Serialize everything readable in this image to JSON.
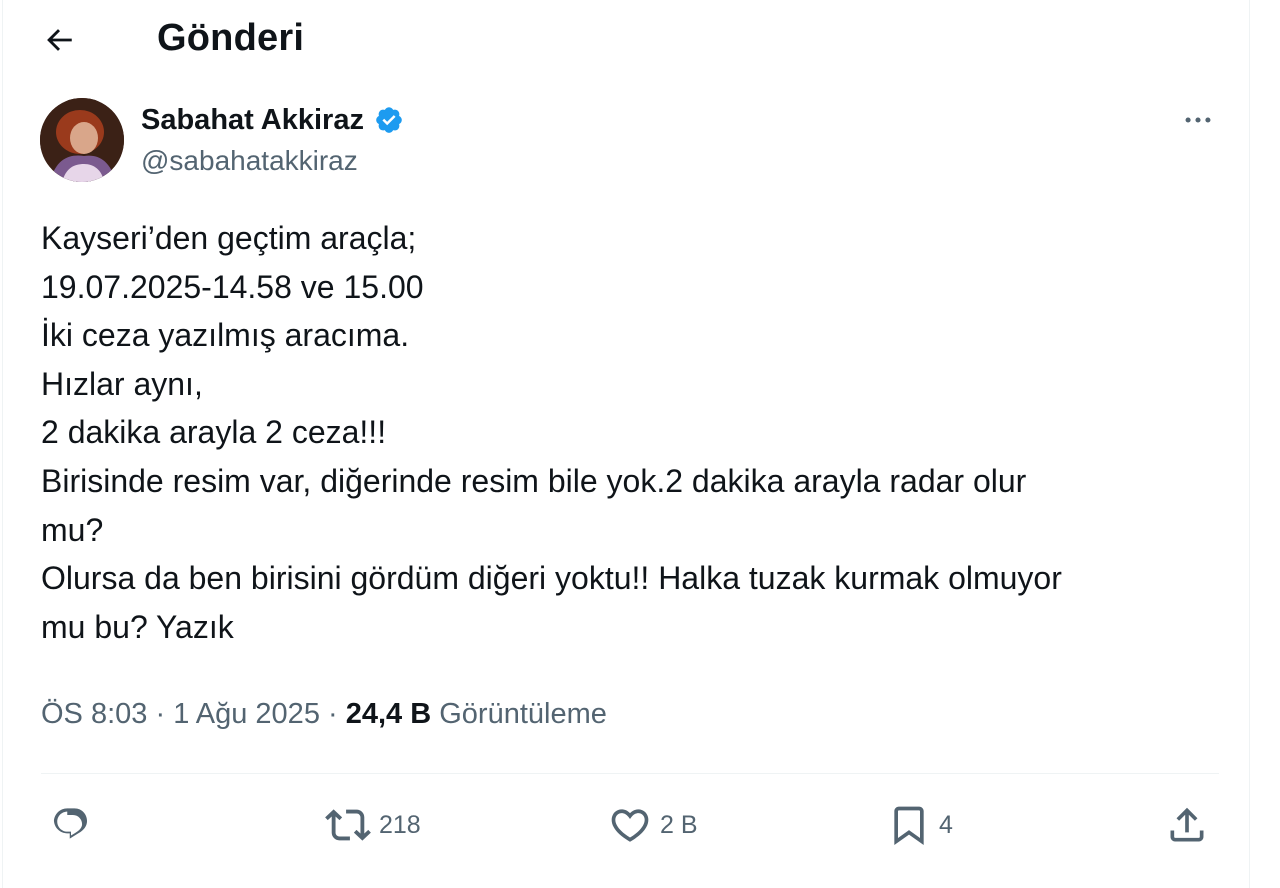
{
  "header": {
    "back_icon": "arrow-left-icon",
    "title": "Gönderi"
  },
  "author": {
    "display_name": "Sabahat Akkiraz",
    "handle": "@sabahatakkiraz",
    "verified_icon": "verified-badge-icon",
    "verified_color": "#1d9bf0",
    "more_icon": "more-horizontal-icon"
  },
  "tweet": {
    "lines": [
      "Kayseri’den geçtim araçla;",
      "19.07.2025-14.58 ve 15.00",
      "İki ceza yazılmış aracıma.",
      "Hızlar aynı,",
      "2 dakika arayla 2 ceza!!!",
      "Birisinde resim var, diğerinde resim bile yok.2 dakika arayla radar olur",
      "mu?",
      "Olursa da ben birisini gördüm diğeri yoktu!! Halka tuzak kurmak olmuyor",
      "mu bu? Yazık"
    ]
  },
  "meta": {
    "time": "ÖS 8:03",
    "separator": "·",
    "date": "1 Ağu 2025",
    "views_count": "24,4 B",
    "views_label": "Görüntüleme"
  },
  "actions": {
    "reply": {
      "icon": "reply-icon",
      "count": ""
    },
    "retweet": {
      "icon": "retweet-icon",
      "count": "218"
    },
    "like": {
      "icon": "heart-icon",
      "count": "2 B"
    },
    "bookmark": {
      "icon": "bookmark-icon",
      "count": "4"
    },
    "share": {
      "icon": "share-icon",
      "count": ""
    }
  },
  "colors": {
    "text_primary": "#0f1419",
    "text_secondary": "#536471",
    "divider": "#eff3f4",
    "accent": "#1d9bf0"
  }
}
